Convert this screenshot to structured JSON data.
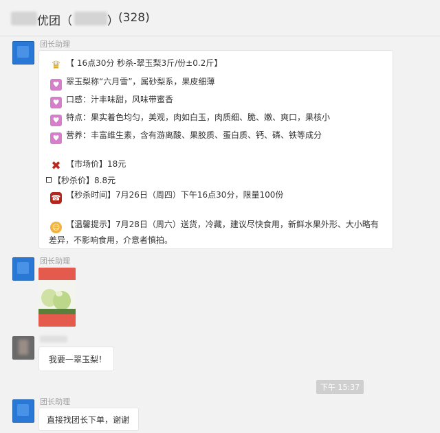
{
  "header": {
    "title_mid": "优团（",
    "title_close": "）",
    "member_count": "(328)"
  },
  "messages": [
    {
      "sender": "团长助理",
      "lines": [
        {
          "icon": "crown-icon",
          "text": "【 16点30分 秒杀-翠玉梨3斤/份±0.2斤】"
        },
        {
          "icon": "heart-icon",
          "text": "翠玉梨称“六月雪”，属砂梨系，果皮细薄"
        },
        {
          "icon": "heart-icon",
          "text": "口感：汁丰味甜，风味带蜜香"
        },
        {
          "icon": "heart-icon",
          "text": "特点：果实着色均匀，美观，肉如白玉，肉质细、脆、嫩、爽口，果核小"
        },
        {
          "icon": "heart-icon",
          "text": "营养：丰富维生素，含有游离酸、果胶质、蛋白质、钙、磷、铁等成分"
        },
        {
          "icon": "cross-icon",
          "text": "【市场价】18元"
        },
        {
          "icon": "square-icon",
          "text": "【秒杀价】8.8元"
        },
        {
          "icon": "phone-icon",
          "text": "【秒杀时间】7月26日（周四）下午16点30分，限量100份"
        },
        {
          "icon": "face-icon",
          "text": "【温馨提示】7月28日（周六）送货，冷藏，建议尽快食用，新鲜水果外形、大小略有"
        },
        {
          "icon": "",
          "text": "差异，不影响食用，介意者慎拍。"
        }
      ]
    },
    {
      "sender": "团长助理",
      "image": "pear-photo"
    },
    {
      "sender": "",
      "text": "我要一翠玉梨！"
    },
    {
      "time": "下午 15:37"
    },
    {
      "sender": "团长助理",
      "text": "直接找团长下单，谢谢"
    }
  ]
}
